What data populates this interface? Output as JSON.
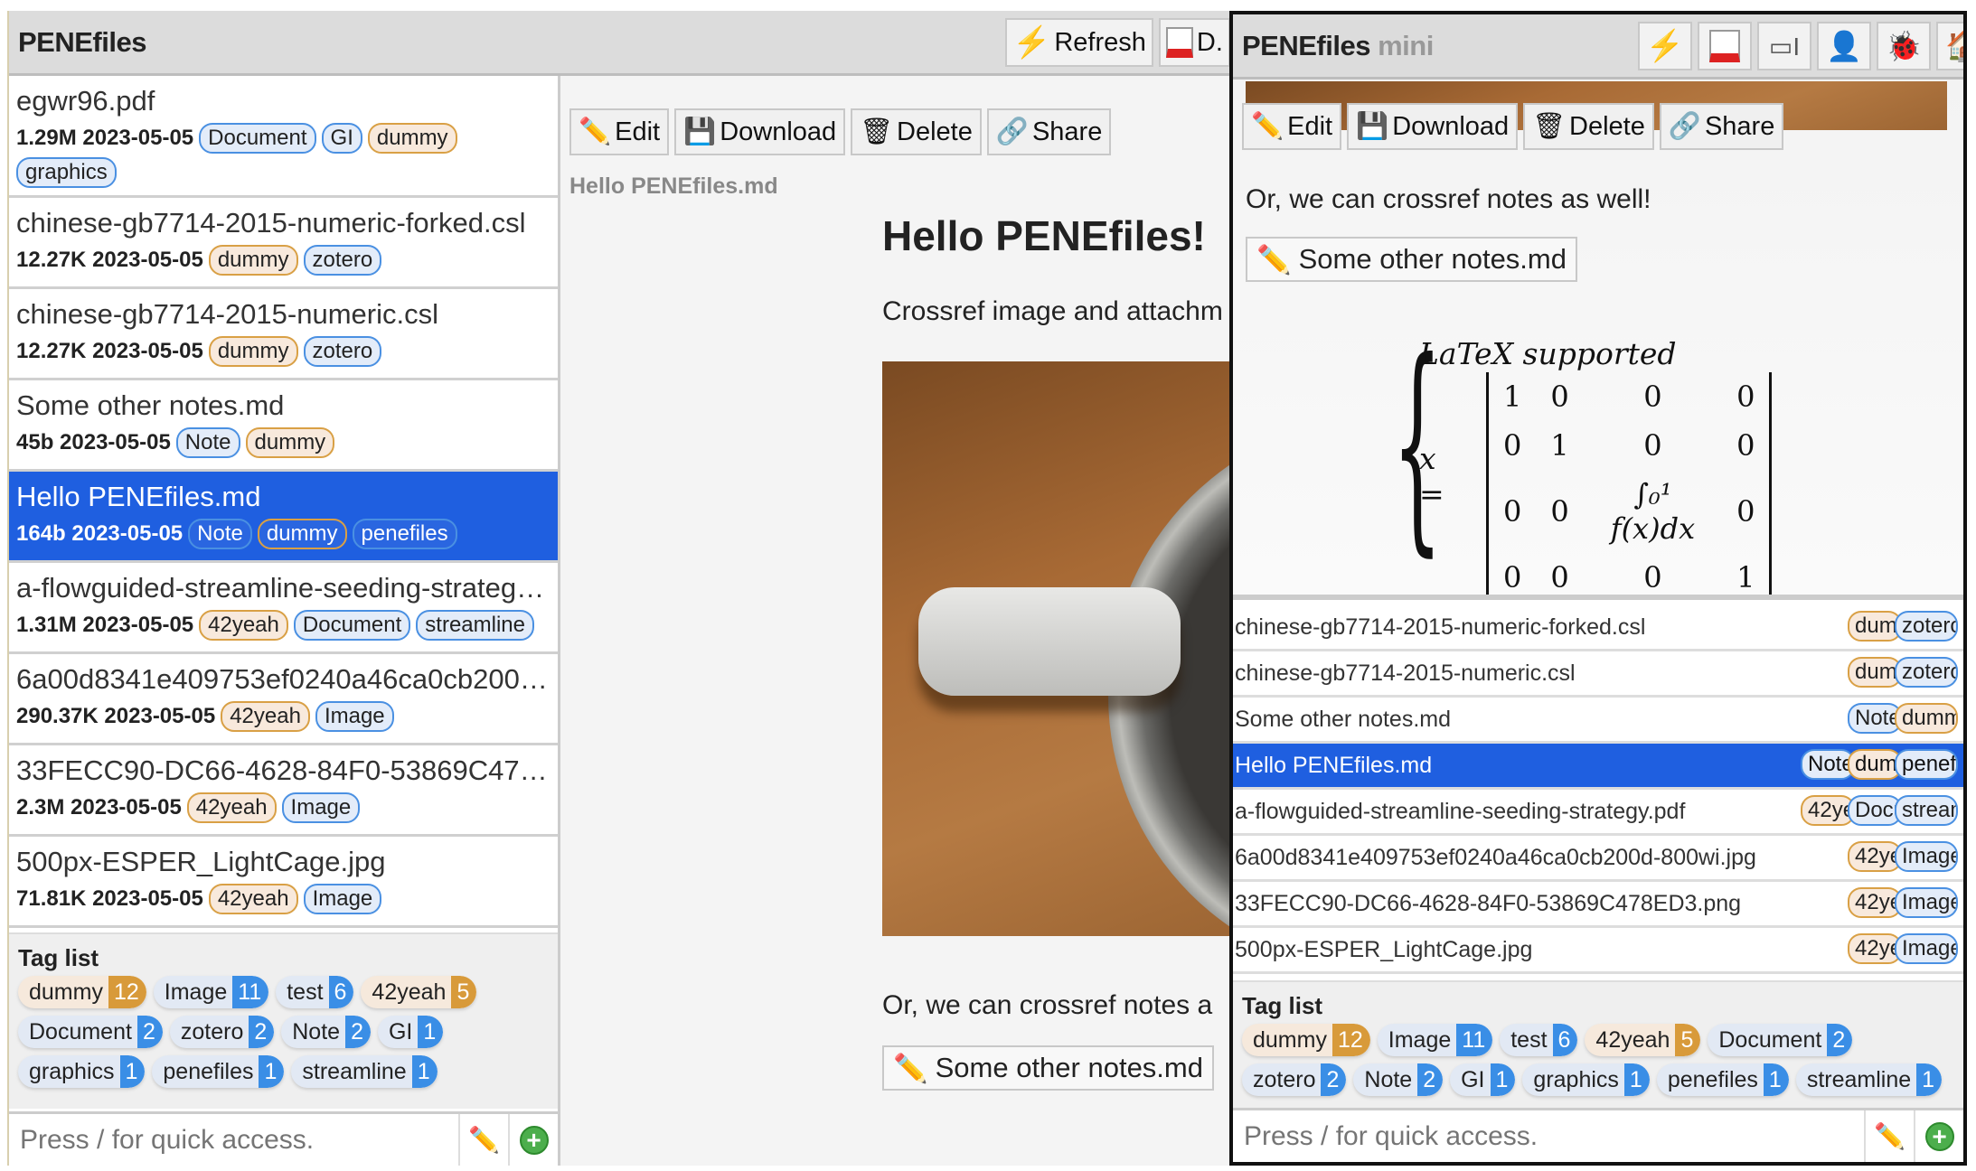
{
  "app": {
    "title": "PENEfiles",
    "header_buttons": [
      {
        "label": "Refresh",
        "icon": "lightning-icon"
      },
      {
        "label": "D.",
        "icon": "calendar-icon"
      }
    ],
    "toolbar": {
      "edit": "Edit",
      "download": "Download",
      "delete": "Delete",
      "share": "Share"
    },
    "path": "Hello PENEfiles.md",
    "doc": {
      "heading": "Hello PENEfiles!",
      "p1": "Crossref image and attachm",
      "p2": "Or, we can crossref notes a",
      "note_link": "Some other notes.md"
    },
    "taglist_title": "Tag list",
    "search_placeholder": "Press / for quick access."
  },
  "mini": {
    "title": "PENEfiles",
    "subtitle": "mini",
    "icons": [
      "lightning-icon",
      "calendar-icon",
      "text-cursor-icon",
      "user-icon",
      "bug-icon",
      "home-icon"
    ],
    "toolbar": {
      "edit": "Edit",
      "download": "Download",
      "delete": "Delete",
      "share": "Share"
    },
    "p2": "Or, we can crossref notes as well!",
    "note_link": "Some other notes.md",
    "latex": {
      "label": "LaTeX supported",
      "lhs": "x =",
      "matrix": [
        [
          "1",
          "0",
          "0",
          "0"
        ],
        [
          "0",
          "1",
          "0",
          "0"
        ],
        [
          "0",
          "0",
          "∫₀¹ f(x)dx",
          "0"
        ],
        [
          "0",
          "0",
          "0",
          "1"
        ]
      ]
    },
    "taglist_title": "Tag list",
    "search_placeholder": "Press / for quick access."
  },
  "files": [
    {
      "name": "egwr96.pdf",
      "size": "1.29M",
      "date": "2023-05-05",
      "tags": [
        "Document",
        "GI",
        "dummy",
        "graphics"
      ]
    },
    {
      "name": "chinese-gb7714-2015-numeric-forked.csl",
      "size": "12.27K",
      "date": "2023-05-05",
      "tags": [
        "dummy",
        "zotero"
      ]
    },
    {
      "name": "chinese-gb7714-2015-numeric.csl",
      "size": "12.27K",
      "date": "2023-05-05",
      "tags": [
        "dummy",
        "zotero"
      ]
    },
    {
      "name": "Some other notes.md",
      "size": "45b",
      "date": "2023-05-05",
      "tags": [
        "Note",
        "dummy"
      ]
    },
    {
      "name": "Hello PENEfiles.md",
      "size": "164b",
      "date": "2023-05-05",
      "tags": [
        "Note",
        "dummy",
        "penefiles"
      ],
      "selected": true
    },
    {
      "name": "a-flowguided-streamline-seeding-strategy.pdf",
      "size": "1.31M",
      "date": "2023-05-05",
      "tags": [
        "42yeah",
        "Document",
        "streamline"
      ]
    },
    {
      "name": "6a00d8341e409753ef0240a46ca0cb200d-800wi.jpg",
      "size": "290.37K",
      "date": "2023-05-05",
      "tags": [
        "42yeah",
        "Image"
      ]
    },
    {
      "name": "33FECC90-DC66-4628-84F0-53869C478ED3.png",
      "size": "2.3M",
      "date": "2023-05-05",
      "tags": [
        "42yeah",
        "Image"
      ]
    },
    {
      "name": "500px-ESPER_LightCage.jpg",
      "size": "71.81K",
      "date": "2023-05-05",
      "tags": [
        "42yeah",
        "Image"
      ]
    }
  ],
  "user_tags": [
    "dummy",
    "42yeah"
  ],
  "tag_counts": [
    {
      "name": "dummy",
      "count": "12"
    },
    {
      "name": "Image",
      "count": "11"
    },
    {
      "name": "test",
      "count": "6"
    },
    {
      "name": "42yeah",
      "count": "5"
    },
    {
      "name": "Document",
      "count": "2"
    },
    {
      "name": "zotero",
      "count": "2"
    },
    {
      "name": "Note",
      "count": "2"
    },
    {
      "name": "GI",
      "count": "1"
    },
    {
      "name": "graphics",
      "count": "1"
    },
    {
      "name": "penefiles",
      "count": "1"
    },
    {
      "name": "streamline",
      "count": "1"
    }
  ],
  "colors": {
    "selected": "#1f5fe0",
    "user_tag": "#d89a3a",
    "system_tag": "#3a8ee6"
  }
}
